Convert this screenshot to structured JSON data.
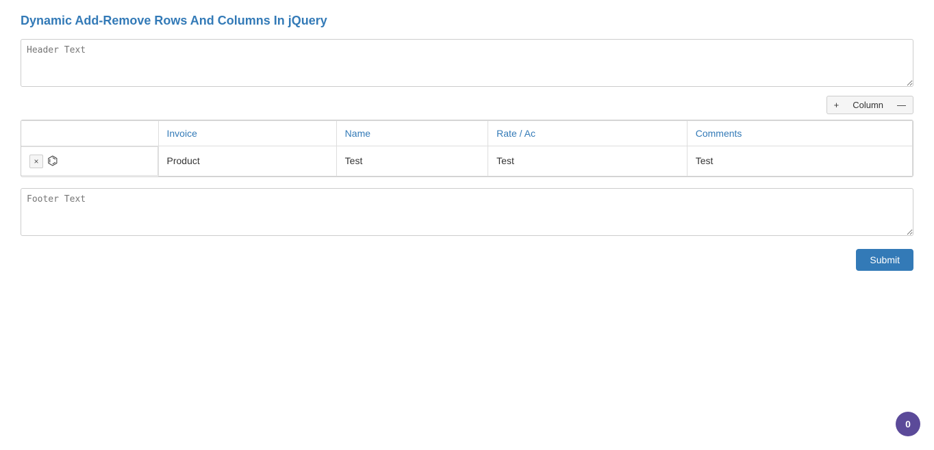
{
  "page": {
    "title_plain": "Dynamic Add-Remove Rows And Columns In ",
    "title_highlight": "jQuery"
  },
  "header_textarea": {
    "placeholder": "Header Text"
  },
  "column_controls": {
    "plus_label": "+",
    "column_label": "Column",
    "minus_label": "—"
  },
  "table": {
    "headers": [
      {
        "id": "blank",
        "label": ""
      },
      {
        "id": "invoice",
        "label": "Invoice"
      },
      {
        "id": "name",
        "label": "Name"
      },
      {
        "id": "rate_ac",
        "label": "Rate / Ac"
      },
      {
        "id": "comments",
        "label": "Comments"
      }
    ],
    "rows": [
      {
        "remove_label": "×",
        "cells": [
          "Product",
          "Test",
          "Test",
          "Test"
        ]
      }
    ]
  },
  "footer_textarea": {
    "placeholder": "Footer Text"
  },
  "submit_button": {
    "label": "Submit"
  },
  "badge": {
    "value": "0"
  }
}
